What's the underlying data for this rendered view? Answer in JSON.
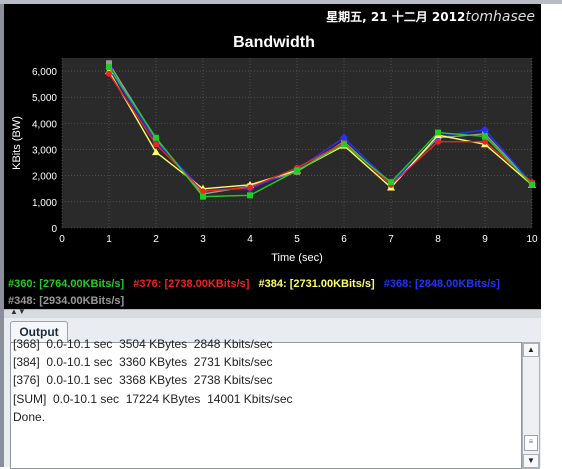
{
  "header": {
    "datetime": "星期五, 21 十二月 2012",
    "user": "tomhasee"
  },
  "colors": {
    "panel_bg": "#000000",
    "plot_bg": "#2a2a2a",
    "grid": "#666666",
    "s360": "#22cc22",
    "s376": "#ee2222",
    "s384": "#ffff66",
    "s368": "#2233ff",
    "s348": "#999999"
  },
  "chart_data": {
    "type": "line",
    "title": "Bandwidth",
    "xlabel": "Time (sec)",
    "ylabel": "KBits (BW)",
    "xlim": [
      0,
      10
    ],
    "ylim": [
      0,
      6500
    ],
    "x_ticks": [
      "0",
      "1",
      "2",
      "3",
      "4",
      "5",
      "6",
      "7",
      "8",
      "9",
      "10"
    ],
    "y_ticks": [
      "0",
      "1,000",
      "2,000",
      "3,000",
      "4,000",
      "5,000",
      "6,000"
    ],
    "x": [
      1,
      2,
      3,
      4,
      5,
      6,
      7,
      8,
      9,
      10
    ],
    "series": [
      {
        "name": "#360",
        "color": "#22cc22",
        "marker": "square",
        "values": [
          6150,
          3450,
          1200,
          1250,
          2200,
          3200,
          1750,
          3650,
          3500,
          1650
        ]
      },
      {
        "name": "#376",
        "color": "#ee2222",
        "marker": "circle",
        "values": [
          5900,
          3200,
          1400,
          1550,
          2300,
          3250,
          1650,
          3300,
          3300,
          1750
        ]
      },
      {
        "name": "#384",
        "color": "#ffff66",
        "marker": "triangle",
        "values": [
          6000,
          2900,
          1500,
          1650,
          2200,
          3150,
          1550,
          3550,
          3200,
          1650
        ]
      },
      {
        "name": "#368",
        "color": "#2233ff",
        "marker": "diamond",
        "values": [
          6100,
          3300,
          1450,
          1500,
          2250,
          3450,
          1700,
          3500,
          3750,
          1700
        ]
      },
      {
        "name": "#348",
        "color": "#999999",
        "marker": "square",
        "values": [
          6300,
          3400,
          1300,
          1600,
          2150,
          3300,
          1650,
          3450,
          3600,
          1700
        ]
      }
    ]
  },
  "legend": {
    "row1": [
      {
        "text": "#360: [2764.00KBits/s]",
        "color": "#22cc22"
      },
      {
        "text": "#376: [2738.00KBits/s]",
        "color": "#ee2222"
      },
      {
        "text": "#384: [2731.00KBits/s]",
        "color": "#ffff66"
      },
      {
        "text": "#368: [2848.00KBits/s]",
        "color": "#2233ff"
      }
    ],
    "row2": [
      {
        "text": "#348: [2934.00KBits/s]",
        "color": "#999999"
      }
    ]
  },
  "output": {
    "tab_label": "Output",
    "lines": [
      "[368]  0.0-10.1 sec  3504 KBytes  2848 Kbits/sec",
      "[384]  0.0-10.1 sec  3360 KBytes  2731 Kbits/sec",
      "[376]  0.0-10.1 sec  3368 KBytes  2738 Kbits/sec",
      "[SUM]  0.0-10.1 sec  17224 KBytes  14001 Kbits/sec",
      "Done."
    ]
  }
}
